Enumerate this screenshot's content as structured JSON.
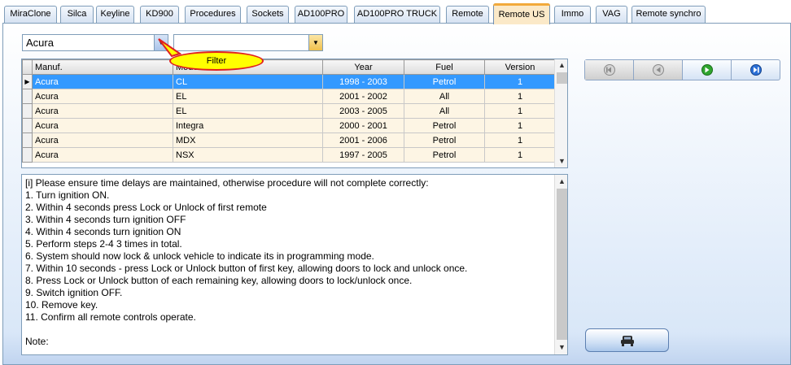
{
  "tabs": [
    {
      "label": "MiraClone",
      "active": false
    },
    {
      "label": "Silca",
      "active": false
    },
    {
      "label": "Keyline",
      "active": false
    },
    {
      "label": "KD900",
      "active": false
    },
    {
      "label": "Procedures",
      "active": false
    },
    {
      "label": "Sockets",
      "active": false
    },
    {
      "label": "AD100PRO",
      "active": false
    },
    {
      "label": "AD100PRO TRUCK",
      "active": false
    },
    {
      "label": "Remote",
      "active": false
    },
    {
      "label": "Remote US",
      "active": true
    },
    {
      "label": "Immo",
      "active": false
    },
    {
      "label": "VAG",
      "active": false
    },
    {
      "label": "Remote synchro",
      "active": false
    }
  ],
  "make_select": {
    "value": "Acura"
  },
  "model_filter": {
    "value": ""
  },
  "filter_tooltip": {
    "label": "Filter"
  },
  "grid": {
    "columns": [
      "Manuf.",
      "Model",
      "Year",
      "Fuel",
      "Version"
    ],
    "rows": [
      [
        "Acura",
        "CL",
        "1998 - 2003",
        "Petrol",
        "1"
      ],
      [
        "Acura",
        "EL",
        "2001 - 2002",
        "All",
        "1"
      ],
      [
        "Acura",
        "EL",
        "2003 - 2005",
        "All",
        "1"
      ],
      [
        "Acura",
        "Integra",
        "2000 - 2001",
        "Petrol",
        "1"
      ],
      [
        "Acura",
        "MDX",
        "2001 - 2006",
        "Petrol",
        "1"
      ],
      [
        "Acura",
        "NSX",
        "1997 - 2005",
        "Petrol",
        "1"
      ]
    ],
    "selected_index": 0
  },
  "procedure_text": [
    "[i] Please ensure time delays are maintained, otherwise procedure will not complete correctly:",
    "1. Turn ignition ON.",
    "2. Within 4 seconds press Lock or Unlock of first remote",
    "3. Within 4 seconds turn ignition OFF",
    "4. Within 4 seconds turn ignition ON",
    "5. Perform steps 2-4 3 times in total.",
    "6. System should now lock & unlock vehicle to indicate its in programming mode.",
    "7. Within 10 seconds - press Lock or Unlock button of first key, allowing doors to lock and unlock once.",
    "8. Press Lock or Unlock button of each remaining key, allowing doors to lock/unlock once.",
    "9. Switch ignition OFF.",
    "10. Remove key.",
    "11. Confirm all remote controls operate.",
    "",
    "Note:"
  ],
  "nav_icons": [
    "first-record-icon",
    "previous-record-icon",
    "next-record-icon",
    "last-record-icon"
  ],
  "car_button_icon": "car-seat-icon",
  "colors": {
    "active_tab": "#fbe9c8",
    "active_tab_accent": "#f2a93b",
    "selection": "#3399ff",
    "row_background": "#fdf5e4",
    "tooltip_fill": "#ffff00",
    "tooltip_border": "#e02020"
  }
}
